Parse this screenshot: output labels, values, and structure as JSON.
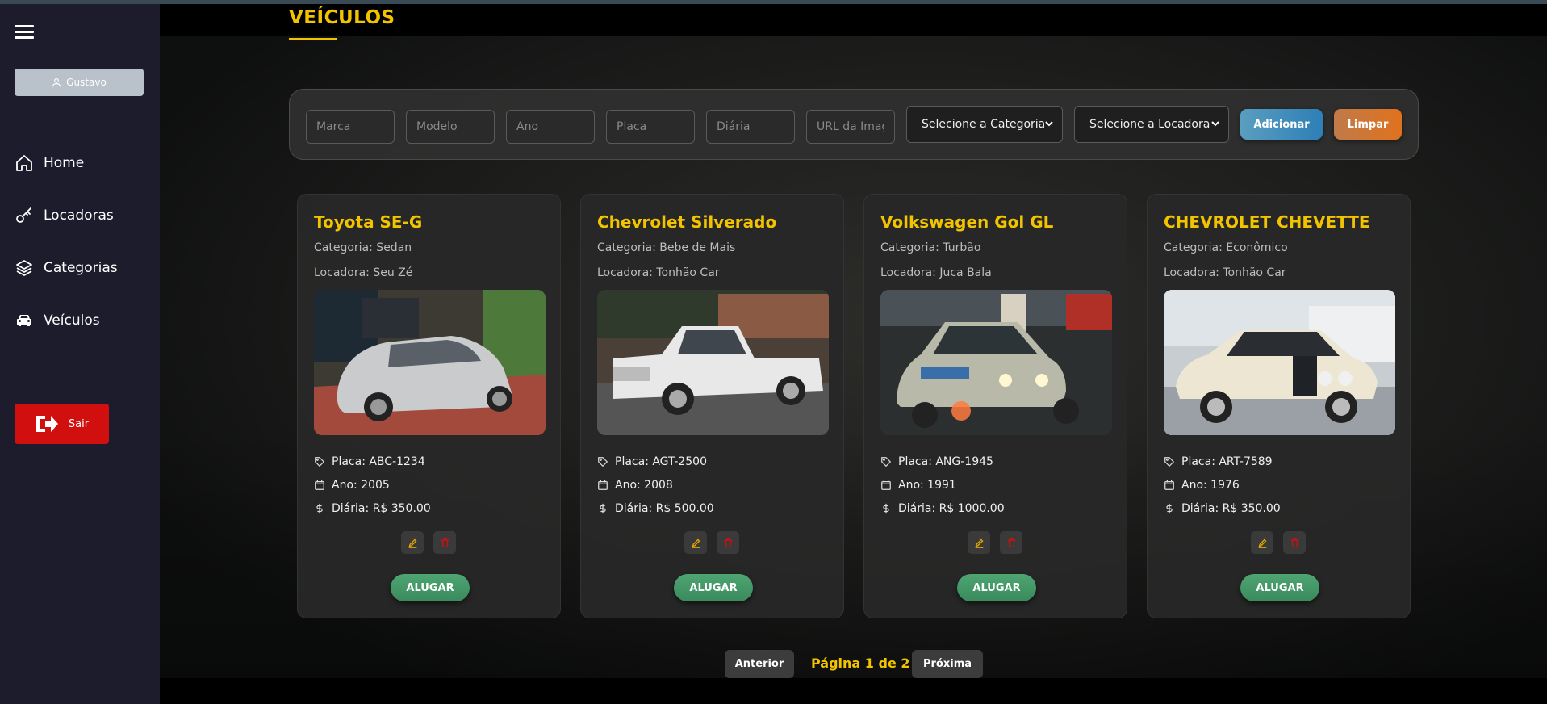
{
  "sidebar": {
    "user_label": "Gustavo",
    "nav": [
      {
        "label": "Home",
        "icon": "home-icon"
      },
      {
        "label": "Locadoras",
        "icon": "key-icon"
      },
      {
        "label": "Categorias",
        "icon": "layers-icon"
      },
      {
        "label": "Veículos",
        "icon": "car-icon"
      }
    ],
    "logout_label": "Sair"
  },
  "page": {
    "title": "VEÍCULOS"
  },
  "form": {
    "placeholders": {
      "marca": "Marca",
      "modelo": "Modelo",
      "ano": "Ano",
      "placa": "Placa",
      "diaria": "Diária",
      "url": "URL da Imagem"
    },
    "category_select": "Selecione a Categoria",
    "locadora_select": "Selecione a Locadora",
    "add_label": "Adicionar",
    "clear_label": "Limpar"
  },
  "vehicles": [
    {
      "title": "Toyota SE-G",
      "categoria": "Categoria: Sedan",
      "locadora": "Locadora: Seu Zé",
      "placa": "Placa: ABC-1234",
      "ano": "Ano: 2005",
      "diaria": "Diária: R$ 350.00",
      "rent": "ALUGAR"
    },
    {
      "title": "Chevrolet Silverado",
      "categoria": "Categoria: Bebe de Mais",
      "locadora": "Locadora: Tonhão Car",
      "placa": "Placa: AGT-2500",
      "ano": "Ano: 2008",
      "diaria": "Diária: R$ 500.00",
      "rent": "ALUGAR"
    },
    {
      "title": "Volkswagen Gol GL",
      "categoria": "Categoria: Turbão",
      "locadora": "Locadora: Juca Bala",
      "placa": "Placa: ANG-1945",
      "ano": "Ano: 1991",
      "diaria": "Diária: R$ 1000.00",
      "rent": "ALUGAR"
    },
    {
      "title": "CHEVROLET CHEVETTE",
      "categoria": "Categoria: Econômico",
      "locadora": "Locadora: Tonhão Car",
      "placa": "Placa: ART-7589",
      "ano": "Ano: 1976",
      "diaria": "Diária: R$ 350.00",
      "rent": "ALUGAR"
    }
  ],
  "pagination": {
    "prev_label": "Anterior",
    "page_text": "Página 1 de 2",
    "next_label": "Próxima"
  },
  "colors": {
    "accent": "#f2c400",
    "sidebar_bg": "#1c1c2c",
    "logout": "#d10f0f",
    "add": "#2d7fb6",
    "clear": "#e0721d",
    "rent": "#3a8a5c",
    "edit_icon": "#e0a800",
    "delete_icon": "#d10f0f"
  }
}
